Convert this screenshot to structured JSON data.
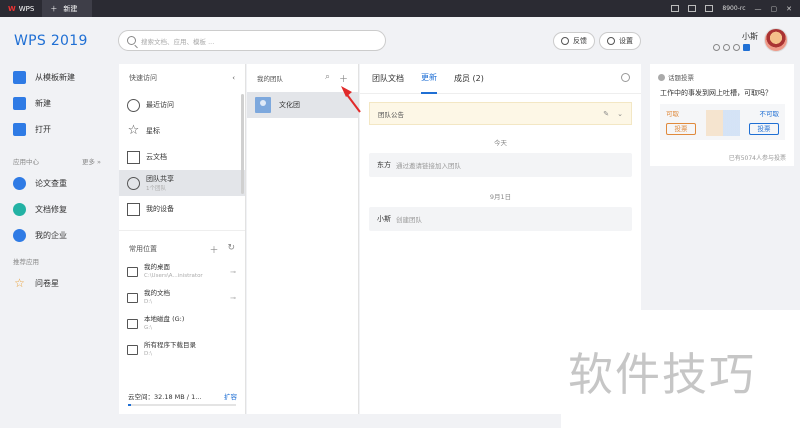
{
  "titlebar": {
    "app_tab": "WPS",
    "new_tab": "新建",
    "account": "8900-rc"
  },
  "brand": "WPS 2019",
  "search": {
    "placeholder": "搜索文档、应用、模板 ..."
  },
  "header": {
    "feedback": "反馈",
    "settings": "设置",
    "username": "小斯"
  },
  "leftnav": {
    "items": [
      {
        "label": "从模板新建",
        "icon": "template-icon"
      },
      {
        "label": "新建",
        "icon": "plus-icon"
      },
      {
        "label": "打开",
        "icon": "folder-icon"
      }
    ],
    "app_center": "应用中心",
    "more": "更多 »",
    "apps": [
      {
        "label": "论文查重",
        "icon": "paper-check-icon"
      },
      {
        "label": "文档修复",
        "icon": "doc-repair-icon"
      },
      {
        "label": "我的企业",
        "icon": "enterprise-icon"
      }
    ],
    "recommend": "推荐应用",
    "rec_apps": [
      {
        "label": "问卷星",
        "icon": "star-icon"
      }
    ]
  },
  "quick_access": {
    "title": "快速访问",
    "items": [
      {
        "label": "最近访问",
        "sub": ""
      },
      {
        "label": "星标",
        "sub": ""
      },
      {
        "label": "云文档",
        "sub": ""
      },
      {
        "label": "团队共享",
        "sub": "1个团队"
      },
      {
        "label": "我的设备",
        "sub": ""
      }
    ],
    "common_title": "常用位置",
    "locations": [
      {
        "label": "我的桌面",
        "path": "C:\\Users\\A...inistrator"
      },
      {
        "label": "我的文档",
        "path": "D:\\"
      },
      {
        "label": "本地磁盘 (G:)",
        "path": "G:\\"
      },
      {
        "label": "所有程序下载目录",
        "path": "D:\\"
      }
    ],
    "cloud": "云空间：32.18 MB / 1...",
    "cloud_expand": "扩容",
    "cloud_fraction": 0.03
  },
  "my_team": {
    "title": "我的团队",
    "team_name": "文化团"
  },
  "team_panel": {
    "tabs": [
      "团队文档",
      "更新",
      "成员 (2)"
    ],
    "notice": "团队公告",
    "groups": [
      {
        "date": "今天",
        "who": "东方",
        "action": "通过邀请链接加入团队"
      },
      {
        "date": "9月1日",
        "who": "小斯",
        "action": "创建团队"
      }
    ]
  },
  "vote": {
    "title": "话题投票",
    "question": "工作中的事发到网上吐槽，可取吗？",
    "left": "可取",
    "right": "不可取",
    "left_btn": "投票",
    "right_btn": "投票",
    "footer": "已有5074人参与投票"
  },
  "watermark": "软件技巧"
}
